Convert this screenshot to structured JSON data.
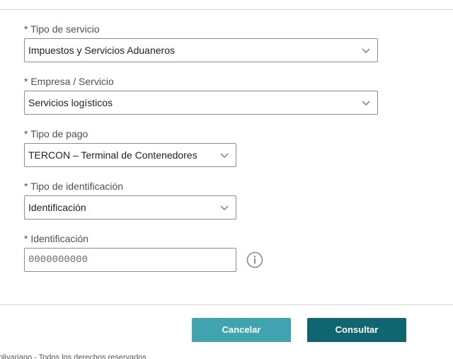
{
  "form": {
    "service_type": {
      "label": "* Tipo de servicio",
      "value": "Impuestos y Servicios Aduaneros"
    },
    "company_service": {
      "label": "* Empresa / Servicio",
      "value": "Servicios logísticos"
    },
    "payment_type": {
      "label": "* Tipo de pago",
      "value": "TERCON – Terminal de Contenedores"
    },
    "id_type": {
      "label": "* Tipo de identificación",
      "value": "Identificación"
    },
    "identification": {
      "label": "* Identificación",
      "placeholder": "0000000000",
      "value": ""
    }
  },
  "actions": {
    "cancel_label": "Cancelar",
    "submit_label": "Consultar"
  },
  "footer": {
    "text": "olivariano - Todos los derechos reservados"
  },
  "icons": {
    "select_arrow": "chevron-down-icon",
    "help": "info-icon"
  },
  "colors": {
    "cancel_button": "#3fa3b0",
    "submit_button": "#0f6670",
    "border": "#8d8d8d"
  }
}
